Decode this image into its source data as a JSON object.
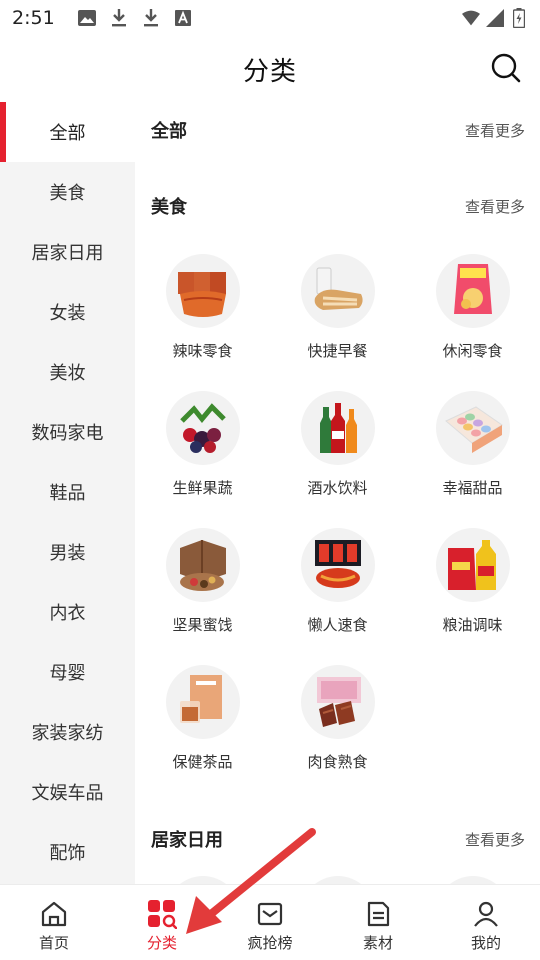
{
  "status_bar": {
    "time": "2:51",
    "left_icons": [
      "image-icon",
      "download-icon",
      "download-icon",
      "font-icon"
    ],
    "right_icons": [
      "wifi-icon",
      "signal-icon",
      "battery-icon"
    ]
  },
  "header": {
    "title": "分类",
    "search_icon": "search-icon"
  },
  "sidebar": {
    "items": [
      {
        "label": "全部",
        "active": true
      },
      {
        "label": "美食",
        "active": false
      },
      {
        "label": "居家日用",
        "active": false
      },
      {
        "label": "女装",
        "active": false
      },
      {
        "label": "美妆",
        "active": false
      },
      {
        "label": "数码家电",
        "active": false
      },
      {
        "label": "鞋品",
        "active": false
      },
      {
        "label": "男装",
        "active": false
      },
      {
        "label": "内衣",
        "active": false
      },
      {
        "label": "母婴",
        "active": false
      },
      {
        "label": "家装家纺",
        "active": false
      },
      {
        "label": "文娱车品",
        "active": false
      },
      {
        "label": "配饰",
        "active": false
      }
    ]
  },
  "main": {
    "sections": [
      {
        "title": "全部",
        "more": "查看更多",
        "items": []
      },
      {
        "title": "美食",
        "more": "查看更多",
        "items": [
          {
            "label": "辣味零食",
            "icon": "spicy-snack-image"
          },
          {
            "label": "快捷早餐",
            "icon": "bread-milk-image"
          },
          {
            "label": "休闲零食",
            "icon": "chips-bag-image"
          },
          {
            "label": "生鲜果蔬",
            "icon": "berries-image"
          },
          {
            "label": "酒水饮料",
            "icon": "drink-bottles-image"
          },
          {
            "label": "幸福甜品",
            "icon": "macaron-box-image"
          },
          {
            "label": "坚果蜜饯",
            "icon": "nut-gift-box-image"
          },
          {
            "label": "懒人速食",
            "icon": "instant-noodles-image"
          },
          {
            "label": "粮油调味",
            "icon": "rice-oil-image"
          },
          {
            "label": "保健茶品",
            "icon": "tea-box-image"
          },
          {
            "label": "肉食熟食",
            "icon": "braised-meat-image"
          }
        ]
      },
      {
        "title": "居家日用",
        "more": "查看更多",
        "items": [
          {
            "label": "",
            "icon": "home-goods-image"
          },
          {
            "label": "",
            "icon": "home-goods-image"
          },
          {
            "label": "",
            "icon": "home-goods-image"
          }
        ]
      }
    ]
  },
  "bottom_nav": {
    "items": [
      {
        "label": "首页",
        "icon": "home-icon",
        "active": false
      },
      {
        "label": "分类",
        "icon": "category-icon",
        "active": true
      },
      {
        "label": "疯抢榜",
        "icon": "ranking-icon",
        "active": false
      },
      {
        "label": "素材",
        "icon": "material-icon",
        "active": false
      },
      {
        "label": "我的",
        "icon": "profile-icon",
        "active": false
      }
    ]
  },
  "colors": {
    "accent": "#e5212f",
    "sidebar_bg": "#f4f4f4",
    "annotation_arrow": "#e23b3b"
  }
}
